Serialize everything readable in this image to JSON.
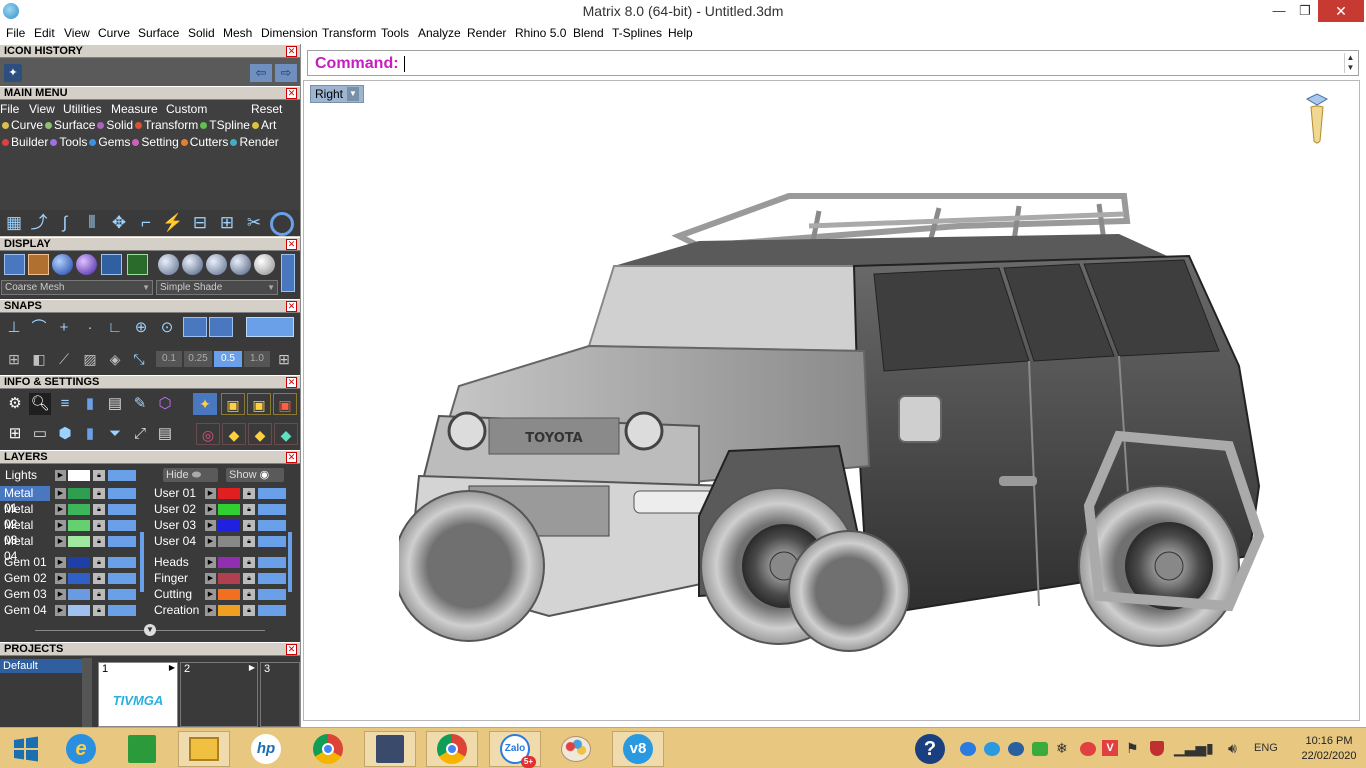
{
  "window": {
    "title": "Matrix 8.0 (64-bit) - Untitled.3dm",
    "minimize": "—",
    "maximize": "❐",
    "close": "✕"
  },
  "menu": [
    "File",
    "Edit",
    "View",
    "Curve",
    "Surface",
    "Solid",
    "Mesh",
    "Dimension",
    "Transform",
    "Tools",
    "Analyze",
    "Render",
    "Rhino 5.0",
    "Blend",
    "T-Splines",
    "Help"
  ],
  "panels": {
    "icon_history": {
      "title": "ICON HISTORY"
    },
    "main_menu": {
      "title": "MAIN MENU",
      "menu_row": [
        "File",
        "View",
        "Utilities",
        "Measure",
        "Custom"
      ],
      "reset": "Reset",
      "row1": [
        {
          "label": "Curve",
          "color": "#d8c050"
        },
        {
          "label": "Surface",
          "color": "#8fc070"
        },
        {
          "label": "Solid",
          "color": "#b060c0"
        },
        {
          "label": "Transform",
          "color": "#e05030"
        },
        {
          "label": "TSpline",
          "color": "#60c050"
        },
        {
          "label": "Art",
          "color": "#e0c040"
        }
      ],
      "row2": [
        {
          "label": "Builder",
          "color": "#e04040"
        },
        {
          "label": "Tools",
          "color": "#a070e0"
        },
        {
          "label": "Gems",
          "color": "#4090e0"
        },
        {
          "label": "Setting",
          "color": "#d060c0"
        },
        {
          "label": "Cutters",
          "color": "#e08030"
        },
        {
          "label": "Render",
          "color": "#40b0c0"
        }
      ]
    },
    "display": {
      "title": "DISPLAY",
      "mesh_select": "Coarse Mesh",
      "shade_select": "Simple Shade"
    },
    "snaps": {
      "title": "SNAPS",
      "values": [
        "0.1",
        "0.25",
        "0.5",
        "1.0"
      ]
    },
    "info": {
      "title": "INFO & SETTINGS"
    },
    "layers": {
      "title": "LAYERS",
      "lights": "Lights",
      "hide": "Hide",
      "show": "Show",
      "left": [
        {
          "name": "Metal 01",
          "color": "#2e9e50",
          "selected": true
        },
        {
          "name": "Metal 02",
          "color": "#3db55a"
        },
        {
          "name": "Metal 03",
          "color": "#66d070"
        },
        {
          "name": "Metal 04",
          "color": "#a0e8a0"
        },
        {
          "name": "Gem 01",
          "color": "#1f3fa8"
        },
        {
          "name": "Gem 02",
          "color": "#2f60c8"
        },
        {
          "name": "Gem 03",
          "color": "#6a9ae0"
        },
        {
          "name": "Gem 04",
          "color": "#a0c0f0"
        }
      ],
      "right": [
        {
          "name": "User 01",
          "color": "#e02020"
        },
        {
          "name": "User 02",
          "color": "#30d030"
        },
        {
          "name": "User 03",
          "color": "#2020e0"
        },
        {
          "name": "User 04",
          "color": "#888888"
        },
        {
          "name": "Heads",
          "color": "#9030b0"
        },
        {
          "name": "Finger",
          "color": "#b04050"
        },
        {
          "name": "Cutting",
          "color": "#f07020"
        },
        {
          "name": "Creation",
          "color": "#f0a020"
        }
      ]
    },
    "projects": {
      "title": "PROJECTS",
      "default": "Default",
      "slots": [
        "1",
        "2",
        "3"
      ],
      "thumb_text": "TIVMGA"
    }
  },
  "command": {
    "label": "Command:"
  },
  "viewport": {
    "name": "Right",
    "model": "TOYOTA"
  },
  "taskbar": {
    "apps": [
      "windows-start",
      "internet-explorer",
      "store",
      "file-explorer",
      "hp",
      "chrome",
      "app-window",
      "chrome",
      "zalo",
      "paint",
      "vbox"
    ],
    "zalo_badge": "5+",
    "lang": "ENG",
    "time": "10:16 PM",
    "date": "22/02/2020"
  }
}
